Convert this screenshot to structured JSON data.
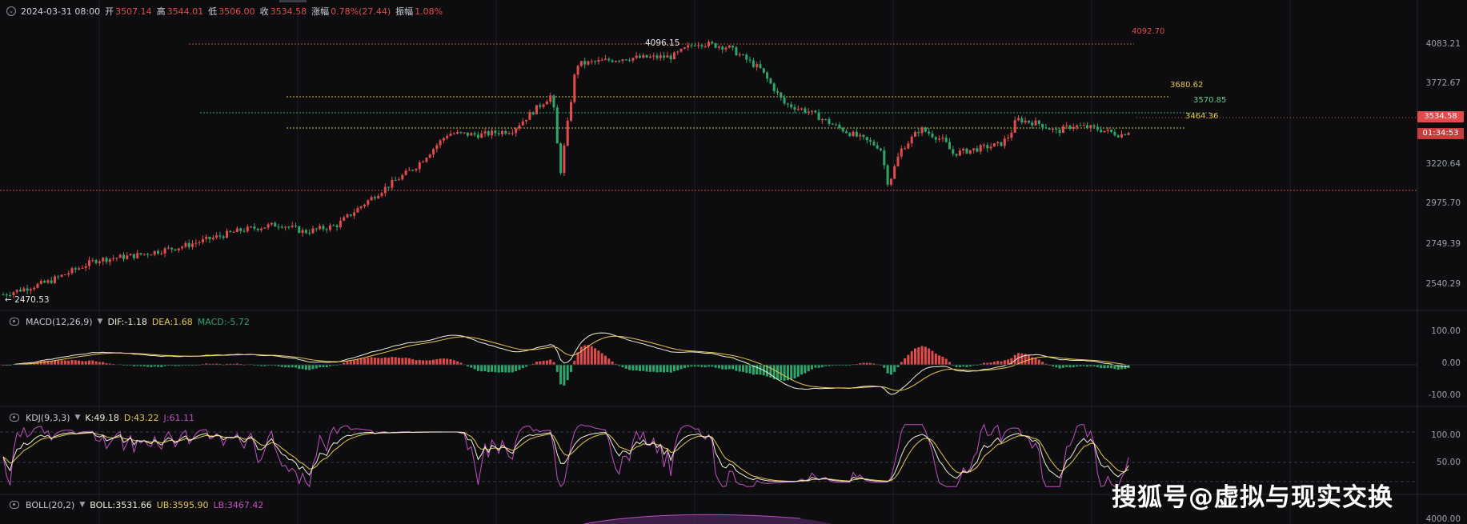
{
  "header": {
    "collapse_icon": "chevron-down-circle-icon",
    "datetime": "2024-03-31 08:00",
    "open_label": "开",
    "open_value": "3507.14",
    "high_label": "高",
    "high_value": "3544.01",
    "low_label": "低",
    "low_value": "3506.00",
    "close_label": "收",
    "close_value": "3534.58",
    "change_label": "涨幅",
    "change_value": "0.78%(27.44)",
    "amplitude_label": "振幅",
    "amplitude_value": "1.08%"
  },
  "price_axis": {
    "labels": [
      "4083.21",
      "3772.67",
      "3534.58",
      "3220.64",
      "2975.70",
      "2749.39",
      "2540.29"
    ],
    "current_price": "3534.58",
    "countdown": "01:34:53"
  },
  "levels": {
    "top_red": "4092.70",
    "peak_label": "4096.15",
    "yellow_high": "3680.62",
    "green_mid": "3570.85",
    "yellow_low": "3464.36",
    "start_low": "2470.53"
  },
  "macd": {
    "name": "MACD(12,26,9)",
    "dif": "DIF:-1.18",
    "dea": "DEA:1.68",
    "macd": "MACD:-5.72",
    "axis": [
      "100.00",
      "0.00",
      "-100.00"
    ]
  },
  "kdj": {
    "name": "KDJ(9,3,3)",
    "k": "K:49.18",
    "d": "D:43.22",
    "j": "J:61.11",
    "axis": [
      "100.00",
      "50.00"
    ]
  },
  "boll": {
    "name": "BOLL(20,2)",
    "boll": "BOLL:3531.66",
    "ub": "UB:3595.90",
    "lb": "LB:3467.42",
    "axis": [
      "4000.00"
    ]
  },
  "watermark": "搜狐号@虚拟与现实交换",
  "colors": {
    "up": "#e14b4b",
    "down": "#2ea66b",
    "dif": "#f2efd8",
    "dea": "#e6c94a",
    "k": "#f2efd8",
    "d": "#e6c94a",
    "j": "#c24fc2"
  }
}
